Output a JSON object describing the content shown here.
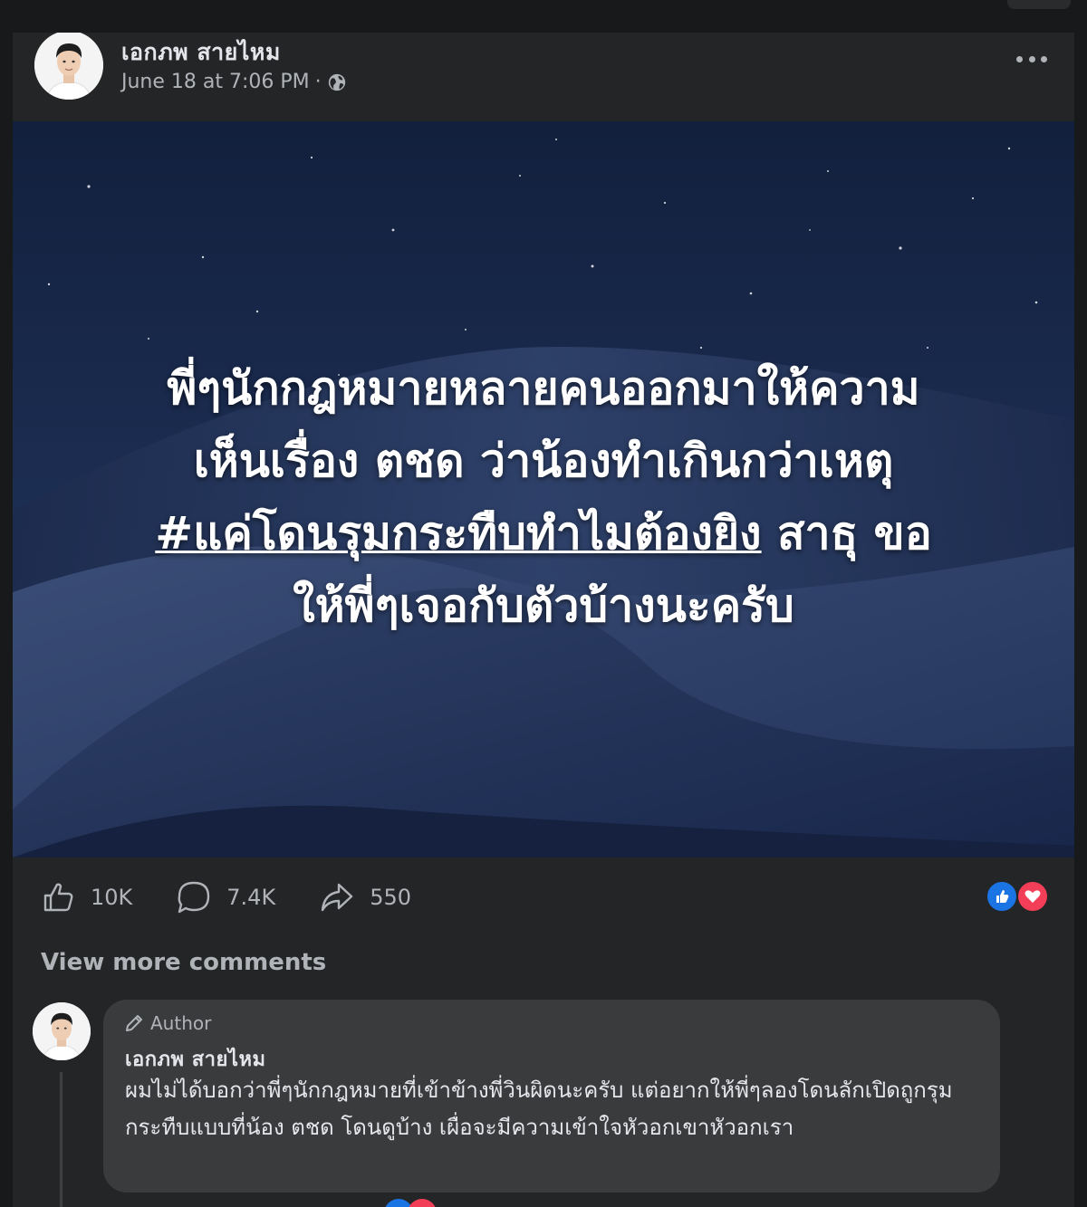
{
  "post": {
    "author": "เอกภพ สายไหม",
    "timestamp": "June 18 at 7:06 PM",
    "separator": "·",
    "privacy_icon": "globe-icon",
    "more_icon": "more-options-icon"
  },
  "image": {
    "lines": [
      "พี่ๆนักกฎหมายหลายคนออกมาให้ความ",
      "เห็นเรื่อง ตชด ว่าน้องทำเกินกว่าเหตุ"
    ],
    "hashtag": "#แค่โดนรุมกระทืบทำไมต้องยิง",
    "line3_rest": " สาธุ ขอ",
    "line4": "ให้พี่ๆเจอกับตัวบ้างนะครับ",
    "background": "night-sky-sand-dunes"
  },
  "stats": {
    "likes": "10K",
    "comments": "7.4K",
    "shares": "550",
    "like_icon": "thumbs-up-icon",
    "comment_icon": "comment-icon",
    "share_icon": "share-icon",
    "reaction_types": [
      "like",
      "love"
    ]
  },
  "view_more_comments": "View more comments",
  "comment": {
    "badge": "Author",
    "author": "เอกภพ สายไหม",
    "text": "ผมไม่ได้บอกว่าพี่ๆนักกฎหมายที่เข้าข้างพี่วินผิดนะครับ แต่อยากให้พี่ๆลองโดนลักเปิดถูกรุมกระทืบแบบที่น้อง ตชด โดนดูบ้าง เผื่อจะมีความเข้าใจหัวอกเขาหัวอกเรา"
  },
  "colors": {
    "background": "#18191a",
    "card": "#242526",
    "bubble": "#3a3b3c",
    "text_primary": "#e4e6eb",
    "text_secondary": "#b0b3b8",
    "like_blue": "#1b74e4",
    "love_red": "#f33e58"
  }
}
